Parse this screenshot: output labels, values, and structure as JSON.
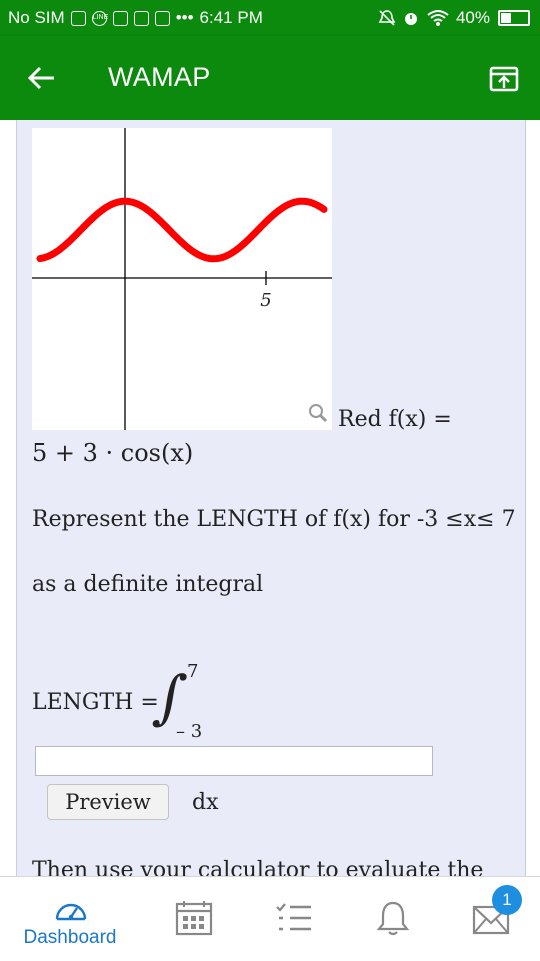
{
  "status_bar": {
    "carrier": "No SIM",
    "line_icon_text": "LINE",
    "more_dots": "•••",
    "time": "6:41 PM",
    "battery": "40%"
  },
  "app_bar": {
    "title": "WAMAP",
    "back_icon": "arrow-left-icon",
    "share_icon": "open-external-icon"
  },
  "question": {
    "graph": {
      "function": "5 + 3·cos(x)",
      "x_tick_label": "5",
      "curve_color": "#ff0000"
    },
    "red_label": "Red f(x) =",
    "formula": "5 + 3 · cos(x)",
    "prompt": "Represent the LENGTH of f(x) for -3 ≤x≤ 7",
    "prompt2": "as a definite integral",
    "length_label": "LENGTH =",
    "integral_sign": "∫",
    "upper_limit": "7",
    "lower_limit": "– 3",
    "answer_value": "",
    "preview_label": "Preview",
    "dx_label": "dx",
    "next_text": "Then use your calculator to evaluate the"
  },
  "bottom_nav": {
    "items": [
      {
        "label": "Dashboard",
        "icon": "speedometer-icon",
        "active": true
      },
      {
        "label": "",
        "icon": "calendar-icon"
      },
      {
        "label": "",
        "icon": "checklist-icon"
      },
      {
        "label": "",
        "icon": "bell-icon"
      },
      {
        "label": "",
        "icon": "mail-icon"
      }
    ],
    "mail_badge": "1"
  },
  "colors": {
    "primary_green": "#0b8a0e",
    "panel_bg": "#e9ecf8",
    "accent_blue": "#1a78c9",
    "badge_blue": "#1e8fe0"
  }
}
